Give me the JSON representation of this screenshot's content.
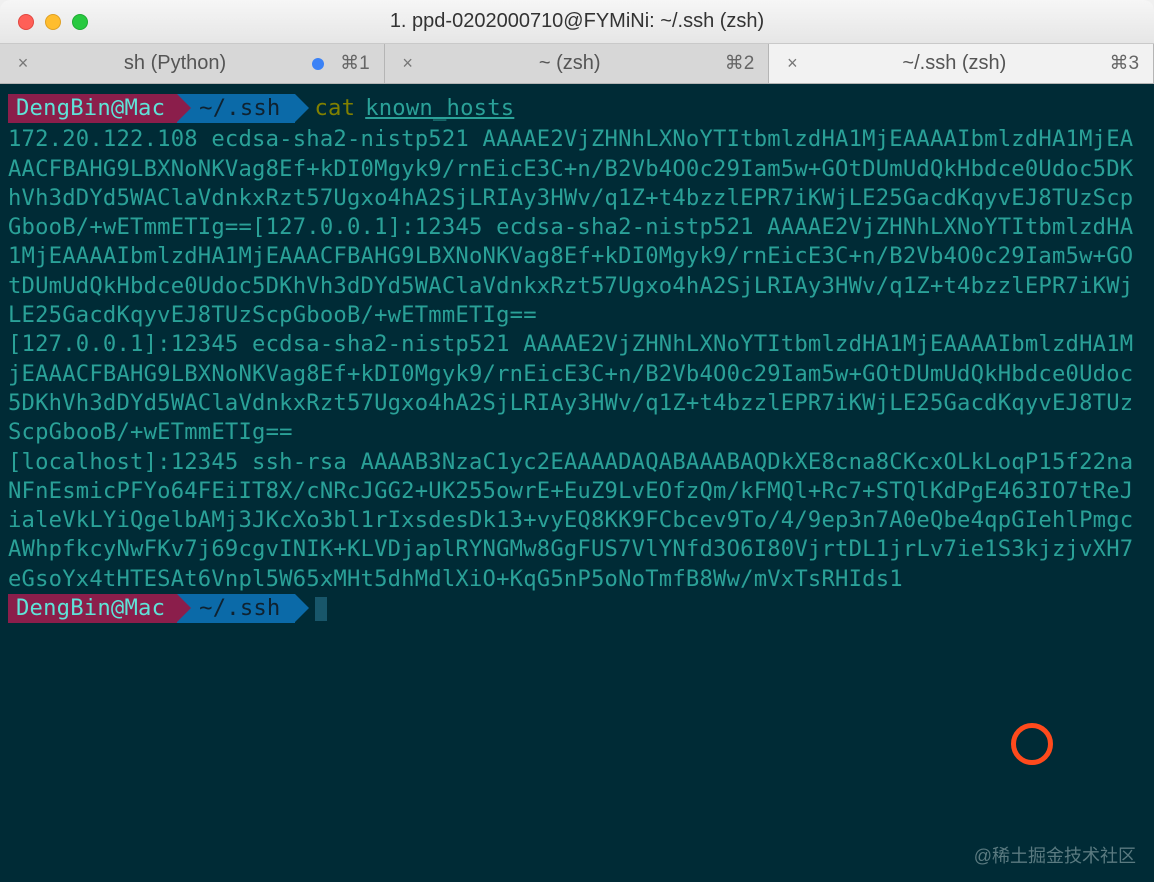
{
  "window": {
    "title": "1. ppd-0202000710@FYMiNi: ~/.ssh (zsh)"
  },
  "tabs": [
    {
      "label": "sh (Python)",
      "shortcut": "⌘1",
      "modified": true
    },
    {
      "label": "~ (zsh)",
      "shortcut": "⌘2",
      "modified": false
    },
    {
      "label": "~/.ssh (zsh)",
      "shortcut": "⌘3",
      "modified": false,
      "active": true
    }
  ],
  "prompt": {
    "user": "DengBin@Mac",
    "path": "~/.ssh",
    "cmd": "cat",
    "arg": "known_hosts"
  },
  "output_lines": [
    "172.20.122.108 ecdsa-sha2-nistp521 AAAAE2VjZHNhLXNoYTItbmlzdHA1MjEAAAAIbmlzdHA1MjEAAACFBAHG9LBXNoNKVag8Ef+kDI0Mgyk9/rnEicE3C+n/B2Vb4O0c29Iam5w+GOtDUmUdQkHbdce0Udoc5DKhVh3dDYd5WAClaVdnkxRzt57Ugxo4hA2SjLRIAy3HWv/q1Z+t4bzzlEPR7iKWjLE25GacdKqyvEJ8TUzScpGbooB/+wETmmETIg==[127.0.0.1]:12345 ecdsa-sha2-nistp521 AAAAE2VjZHNhLXNoYTItbmlzdHA1MjEAAAAIbmlzdHA1MjEAAACFBAHG9LBXNoNKVag8Ef+kDI0Mgyk9/rnEicE3C+n/B2Vb4O0c29Iam5w+GOtDUmUdQkHbdce0Udoc5DKhVh3dDYd5WAClaVdnkxRzt57Ugxo4hA2SjLRIAy3HWv/q1Z+t4bzzlEPR7iKWjLE25GacdKqyvEJ8TUzScpGbooB/+wETmmETIg==",
    "[127.0.0.1]:12345 ecdsa-sha2-nistp521 AAAAE2VjZHNhLXNoYTItbmlzdHA1MjEAAAAIbmlzdHA1MjEAAACFBAHG9LBXNoNKVag8Ef+kDI0Mgyk9/rnEicE3C+n/B2Vb4O0c29Iam5w+GOtDUmUdQkHbdce0Udoc5DKhVh3dDYd5WAClaVdnkxRzt57Ugxo4hA2SjLRIAy3HWv/q1Z+t4bzzlEPR7iKWjLE25GacdKqyvEJ8TUzScpGbooB/+wETmmETIg==",
    "[localhost]:12345 ssh-rsa AAAAB3NzaC1yc2EAAAADAQABAAABAQDkXE8cna8CKcxOLkLoqP15f22naNFnEsmicPFYo64FEiIT8X/cNRcJGG2+UK255owrE+EuZ9LvEOfzQm/kFMQl+Rc7+STQlKdPgE463IO7tReJialeVkLYiQgelbAMj3JKcXo3bl1rIxsdesDk13+vyEQ8KK9FCbcev9To/4/9ep3n7A0eQbe4qpGIehlPmgcAWhpfkcyNwFKv7j69cgvINIK+KLVDjaplRYNGMw8GgFUS7VlYNfd3O6I80VjrtDL1jrLv7ie1S3kjzjvXH7eGsoYx4tHTESAt6Vnpl5W65xMHt5dhMdlXiO+KqG5nP5oNoTmfB8Ww/mVxTsRHIds1"
  ],
  "watermark": "@稀土掘金技术社区"
}
